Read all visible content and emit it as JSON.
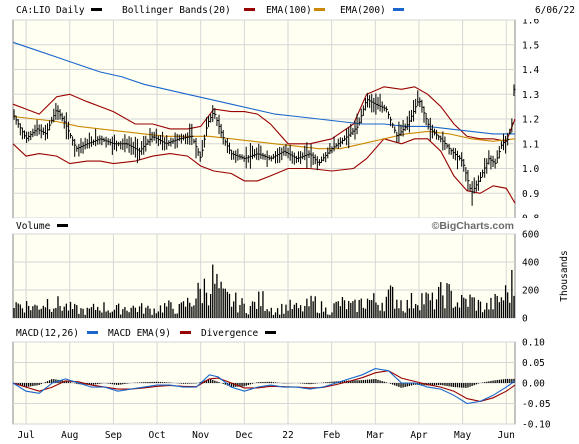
{
  "chart_data": [
    {
      "type": "line",
      "panel": "price",
      "ticker_label": "CA:LIO Daily",
      "date": "6/06/22",
      "legend": [
        {
          "name": "Bollinger Bands(20)",
          "color": "#990000"
        },
        {
          "name": "EMA(100)",
          "color": "#990000"
        },
        {
          "name": "EMA(200)",
          "color": "#cc8800"
        },
        {
          "name": "",
          "color": "#1a66cc"
        }
      ],
      "ylim": [
        0.8,
        1.6
      ],
      "yticks": [
        "1.6",
        "1.5",
        "1.4",
        "1.3",
        "1.2",
        "1.1",
        "1.0",
        "0.9",
        "0.8"
      ],
      "x_labels": [
        "Jul",
        "Aug",
        "Sep",
        "Oct",
        "Nov",
        "Dec",
        "22",
        "Feb",
        "Mar",
        "Apr",
        "May",
        "Jun"
      ],
      "x_positions": [
        0.3,
        1.3,
        2.3,
        3.3,
        4.3,
        5.3,
        6.3,
        7.3,
        8.3,
        9.3,
        10.3,
        11.3
      ],
      "xlim": [
        0,
        11.5
      ],
      "price": [
        [
          0.0,
          1.22
        ],
        [
          0.3,
          1.12
        ],
        [
          0.55,
          1.16
        ],
        [
          0.75,
          1.14
        ],
        [
          1.0,
          1.24
        ],
        [
          1.2,
          1.18
        ],
        [
          1.45,
          1.08
        ],
        [
          1.7,
          1.1
        ],
        [
          2.0,
          1.12
        ],
        [
          2.3,
          1.1
        ],
        [
          2.6,
          1.1
        ],
        [
          2.9,
          1.07
        ],
        [
          3.2,
          1.13
        ],
        [
          3.5,
          1.1
        ],
        [
          3.8,
          1.12
        ],
        [
          4.1,
          1.13
        ],
        [
          4.3,
          1.04
        ],
        [
          4.45,
          1.18
        ],
        [
          4.6,
          1.23
        ],
        [
          4.8,
          1.13
        ],
        [
          5.0,
          1.06
        ],
        [
          5.3,
          1.04
        ],
        [
          5.6,
          1.06
        ],
        [
          5.9,
          1.04
        ],
        [
          6.2,
          1.07
        ],
        [
          6.5,
          1.04
        ],
        [
          6.8,
          1.06
        ],
        [
          7.0,
          1.02
        ],
        [
          7.3,
          1.08
        ],
        [
          7.6,
          1.12
        ],
        [
          7.9,
          1.17
        ],
        [
          8.1,
          1.28
        ],
        [
          8.3,
          1.26
        ],
        [
          8.55,
          1.24
        ],
        [
          8.8,
          1.13
        ],
        [
          9.05,
          1.18
        ],
        [
          9.3,
          1.28
        ],
        [
          9.55,
          1.16
        ],
        [
          9.8,
          1.12
        ],
        [
          10.05,
          1.07
        ],
        [
          10.3,
          1.03
        ],
        [
          10.5,
          0.9
        ],
        [
          10.7,
          0.96
        ],
        [
          10.9,
          1.04
        ],
        [
          11.05,
          1.02
        ],
        [
          11.2,
          1.1
        ],
        [
          11.35,
          1.12
        ],
        [
          11.45,
          1.2
        ],
        [
          11.5,
          1.43
        ]
      ],
      "bollinger_upper": [
        [
          0.0,
          1.26
        ],
        [
          0.3,
          1.24
        ],
        [
          0.6,
          1.22
        ],
        [
          1.0,
          1.29
        ],
        [
          1.3,
          1.3
        ],
        [
          1.7,
          1.27
        ],
        [
          2.0,
          1.25
        ],
        [
          2.3,
          1.23
        ],
        [
          2.8,
          1.18
        ],
        [
          3.2,
          1.18
        ],
        [
          3.6,
          1.16
        ],
        [
          4.0,
          1.16
        ],
        [
          4.3,
          1.17
        ],
        [
          4.6,
          1.24
        ],
        [
          5.0,
          1.23
        ],
        [
          5.3,
          1.23
        ],
        [
          5.6,
          1.22
        ],
        [
          5.9,
          1.18
        ],
        [
          6.3,
          1.1
        ],
        [
          6.8,
          1.1
        ],
        [
          7.3,
          1.12
        ],
        [
          7.8,
          1.18
        ],
        [
          8.1,
          1.3
        ],
        [
          8.5,
          1.33
        ],
        [
          8.9,
          1.32
        ],
        [
          9.2,
          1.33
        ],
        [
          9.5,
          1.3
        ],
        [
          9.8,
          1.25
        ],
        [
          10.1,
          1.18
        ],
        [
          10.4,
          1.13
        ],
        [
          10.7,
          1.12
        ],
        [
          11.0,
          1.12
        ],
        [
          11.3,
          1.11
        ],
        [
          11.5,
          1.2
        ]
      ],
      "bollinger_lower": [
        [
          0.0,
          1.1
        ],
        [
          0.3,
          1.05
        ],
        [
          0.6,
          1.06
        ],
        [
          1.0,
          1.05
        ],
        [
          1.3,
          1.02
        ],
        [
          1.7,
          1.03
        ],
        [
          2.0,
          1.03
        ],
        [
          2.3,
          1.02
        ],
        [
          2.8,
          1.03
        ],
        [
          3.2,
          1.05
        ],
        [
          3.6,
          1.06
        ],
        [
          4.0,
          1.05
        ],
        [
          4.3,
          1.01
        ],
        [
          4.6,
          0.99
        ],
        [
          5.0,
          0.98
        ],
        [
          5.3,
          0.95
        ],
        [
          5.6,
          0.95
        ],
        [
          5.9,
          0.97
        ],
        [
          6.3,
          1.0
        ],
        [
          6.8,
          1.0
        ],
        [
          7.3,
          0.99
        ],
        [
          7.8,
          1.0
        ],
        [
          8.1,
          1.04
        ],
        [
          8.5,
          1.12
        ],
        [
          8.9,
          1.1
        ],
        [
          9.2,
          1.12
        ],
        [
          9.5,
          1.12
        ],
        [
          9.8,
          1.07
        ],
        [
          10.1,
          0.97
        ],
        [
          10.4,
          0.91
        ],
        [
          10.7,
          0.9
        ],
        [
          11.0,
          0.93
        ],
        [
          11.3,
          0.92
        ],
        [
          11.5,
          0.86
        ]
      ],
      "ema100": [
        [
          0.0,
          1.21
        ],
        [
          0.5,
          1.2
        ],
        [
          1.0,
          1.19
        ],
        [
          1.5,
          1.17
        ],
        [
          2.0,
          1.16
        ],
        [
          2.5,
          1.15
        ],
        [
          3.0,
          1.14
        ],
        [
          3.5,
          1.13
        ],
        [
          4.0,
          1.13
        ],
        [
          4.5,
          1.13
        ],
        [
          5.0,
          1.12
        ],
        [
          5.5,
          1.11
        ],
        [
          6.0,
          1.1
        ],
        [
          6.5,
          1.09
        ],
        [
          7.0,
          1.08
        ],
        [
          7.5,
          1.08
        ],
        [
          8.0,
          1.1
        ],
        [
          8.5,
          1.12
        ],
        [
          9.0,
          1.14
        ],
        [
          9.5,
          1.15
        ],
        [
          10.0,
          1.14
        ],
        [
          10.5,
          1.12
        ],
        [
          11.0,
          1.11
        ],
        [
          11.5,
          1.12
        ]
      ],
      "ema200": [
        [
          0.0,
          1.51
        ],
        [
          0.5,
          1.48
        ],
        [
          1.0,
          1.45
        ],
        [
          1.5,
          1.42
        ],
        [
          2.0,
          1.39
        ],
        [
          2.5,
          1.37
        ],
        [
          3.0,
          1.34
        ],
        [
          3.5,
          1.32
        ],
        [
          4.0,
          1.3
        ],
        [
          4.5,
          1.28
        ],
        [
          5.0,
          1.26
        ],
        [
          5.5,
          1.24
        ],
        [
          6.0,
          1.22
        ],
        [
          6.5,
          1.21
        ],
        [
          7.0,
          1.2
        ],
        [
          7.5,
          1.19
        ],
        [
          8.0,
          1.18
        ],
        [
          8.5,
          1.18
        ],
        [
          9.0,
          1.17
        ],
        [
          9.5,
          1.17
        ],
        [
          10.0,
          1.16
        ],
        [
          10.5,
          1.15
        ],
        [
          11.0,
          1.14
        ],
        [
          11.5,
          1.14
        ]
      ]
    },
    {
      "type": "bar",
      "panel": "volume",
      "title": "Volume",
      "watermark": "©BigCharts.com",
      "ylabel": "Thousands",
      "ylim": [
        0,
        600
      ],
      "yticks": [
        "600",
        "400",
        "200",
        "0"
      ],
      "xlim": [
        0,
        11.5
      ],
      "values": [
        [
          0.2,
          140
        ],
        [
          0.5,
          110
        ],
        [
          0.8,
          170
        ],
        [
          1.1,
          130
        ],
        [
          1.4,
          90
        ],
        [
          1.7,
          70
        ],
        [
          2.0,
          120
        ],
        [
          2.3,
          80
        ],
        [
          2.6,
          110
        ],
        [
          2.9,
          100
        ],
        [
          3.2,
          80
        ],
        [
          3.5,
          120
        ],
        [
          3.8,
          90
        ],
        [
          4.1,
          180
        ],
        [
          4.4,
          310
        ],
        [
          4.6,
          380
        ],
        [
          4.8,
          210
        ],
        [
          5.1,
          160
        ],
        [
          5.4,
          100
        ],
        [
          5.7,
          190
        ],
        [
          6.0,
          70
        ],
        [
          6.3,
          120
        ],
        [
          6.6,
          90
        ],
        [
          6.9,
          160
        ],
        [
          7.2,
          70
        ],
        [
          7.5,
          150
        ],
        [
          7.8,
          110
        ],
        [
          8.1,
          180
        ],
        [
          8.4,
          160
        ],
        [
          8.7,
          230
        ],
        [
          9.0,
          120
        ],
        [
          9.3,
          220
        ],
        [
          9.6,
          160
        ],
        [
          9.9,
          260
        ],
        [
          10.2,
          150
        ],
        [
          10.5,
          180
        ],
        [
          10.8,
          100
        ],
        [
          11.1,
          170
        ],
        [
          11.3,
          240
        ],
        [
          11.45,
          340
        ]
      ]
    },
    {
      "type": "line",
      "panel": "macd",
      "legend": [
        {
          "name": "MACD(12,26)",
          "color": "#000000"
        },
        {
          "name": "MACD EMA(9)",
          "color": "#1a66cc"
        },
        {
          "name": "Divergence",
          "color": "#990000"
        },
        {
          "name": "",
          "color": "#000000"
        }
      ],
      "ylim": [
        -0.1,
        0.1
      ],
      "yticks": [
        "0.10",
        "0.05",
        "0.00",
        "-0.05",
        "-0.10"
      ],
      "xlim": [
        0,
        11.5
      ],
      "macd": [
        [
          0.0,
          0.0
        ],
        [
          0.3,
          -0.02
        ],
        [
          0.6,
          -0.025
        ],
        [
          0.9,
          0.0
        ],
        [
          1.2,
          0.01
        ],
        [
          1.5,
          0.0
        ],
        [
          1.8,
          -0.01
        ],
        [
          2.1,
          -0.01
        ],
        [
          2.4,
          -0.02
        ],
        [
          2.7,
          -0.015
        ],
        [
          3.0,
          -0.01
        ],
        [
          3.3,
          -0.005
        ],
        [
          3.6,
          -0.005
        ],
        [
          3.9,
          -0.01
        ],
        [
          4.2,
          -0.01
        ],
        [
          4.5,
          0.02
        ],
        [
          4.7,
          0.015
        ],
        [
          5.0,
          -0.01
        ],
        [
          5.3,
          -0.02
        ],
        [
          5.6,
          -0.01
        ],
        [
          5.9,
          -0.005
        ],
        [
          6.2,
          -0.01
        ],
        [
          6.5,
          -0.01
        ],
        [
          6.8,
          -0.015
        ],
        [
          7.1,
          -0.01
        ],
        [
          7.4,
          0.0
        ],
        [
          7.7,
          0.01
        ],
        [
          8.0,
          0.02
        ],
        [
          8.3,
          0.035
        ],
        [
          8.6,
          0.03
        ],
        [
          8.9,
          0.0
        ],
        [
          9.2,
          0.0
        ],
        [
          9.5,
          -0.01
        ],
        [
          9.8,
          -0.015
        ],
        [
          10.1,
          -0.03
        ],
        [
          10.4,
          -0.05
        ],
        [
          10.7,
          -0.045
        ],
        [
          11.0,
          -0.03
        ],
        [
          11.3,
          -0.01
        ],
        [
          11.5,
          0.005
        ]
      ],
      "signal": [
        [
          0.0,
          0.0
        ],
        [
          0.3,
          -0.01
        ],
        [
          0.6,
          -0.02
        ],
        [
          0.9,
          -0.01
        ],
        [
          1.2,
          0.005
        ],
        [
          1.5,
          0.003
        ],
        [
          1.8,
          -0.005
        ],
        [
          2.1,
          -0.01
        ],
        [
          2.4,
          -0.015
        ],
        [
          2.7,
          -0.015
        ],
        [
          3.0,
          -0.012
        ],
        [
          3.3,
          -0.008
        ],
        [
          3.6,
          -0.006
        ],
        [
          3.9,
          -0.008
        ],
        [
          4.2,
          -0.009
        ],
        [
          4.5,
          0.01
        ],
        [
          4.7,
          0.012
        ],
        [
          5.0,
          0.0
        ],
        [
          5.3,
          -0.012
        ],
        [
          5.6,
          -0.012
        ],
        [
          5.9,
          -0.008
        ],
        [
          6.2,
          -0.009
        ],
        [
          6.5,
          -0.01
        ],
        [
          6.8,
          -0.012
        ],
        [
          7.1,
          -0.011
        ],
        [
          7.4,
          -0.004
        ],
        [
          7.7,
          0.004
        ],
        [
          8.0,
          0.013
        ],
        [
          8.3,
          0.025
        ],
        [
          8.6,
          0.03
        ],
        [
          8.9,
          0.012
        ],
        [
          9.2,
          0.004
        ],
        [
          9.5,
          -0.004
        ],
        [
          9.8,
          -0.01
        ],
        [
          10.1,
          -0.02
        ],
        [
          10.4,
          -0.038
        ],
        [
          10.7,
          -0.045
        ],
        [
          11.0,
          -0.036
        ],
        [
          11.3,
          -0.02
        ],
        [
          11.5,
          -0.005
        ]
      ],
      "divergence": [
        [
          0.0,
          0.0
        ],
        [
          0.3,
          -0.01
        ],
        [
          0.6,
          -0.005
        ],
        [
          0.9,
          0.01
        ],
        [
          1.2,
          0.005
        ],
        [
          1.5,
          -0.003
        ],
        [
          1.8,
          -0.005
        ],
        [
          2.1,
          0.0
        ],
        [
          2.4,
          -0.005
        ],
        [
          2.7,
          0.0
        ],
        [
          3.0,
          0.002
        ],
        [
          3.3,
          0.003
        ],
        [
          3.6,
          0.001
        ],
        [
          3.9,
          -0.002
        ],
        [
          4.2,
          -0.001
        ],
        [
          4.5,
          0.01
        ],
        [
          4.7,
          0.003
        ],
        [
          5.0,
          -0.01
        ],
        [
          5.3,
          -0.008
        ],
        [
          5.6,
          0.002
        ],
        [
          5.9,
          0.003
        ],
        [
          6.2,
          -0.001
        ],
        [
          6.5,
          0.0
        ],
        [
          6.8,
          -0.003
        ],
        [
          7.1,
          0.001
        ],
        [
          7.4,
          0.004
        ],
        [
          7.7,
          0.006
        ],
        [
          8.0,
          0.007
        ],
        [
          8.3,
          0.01
        ],
        [
          8.6,
          0.0
        ],
        [
          8.9,
          -0.012
        ],
        [
          9.2,
          -0.004
        ],
        [
          9.5,
          -0.006
        ],
        [
          9.8,
          -0.005
        ],
        [
          10.1,
          -0.01
        ],
        [
          10.4,
          -0.012
        ],
        [
          10.7,
          0.0
        ],
        [
          11.0,
          0.006
        ],
        [
          11.3,
          0.01
        ],
        [
          11.5,
          0.01
        ]
      ]
    }
  ]
}
